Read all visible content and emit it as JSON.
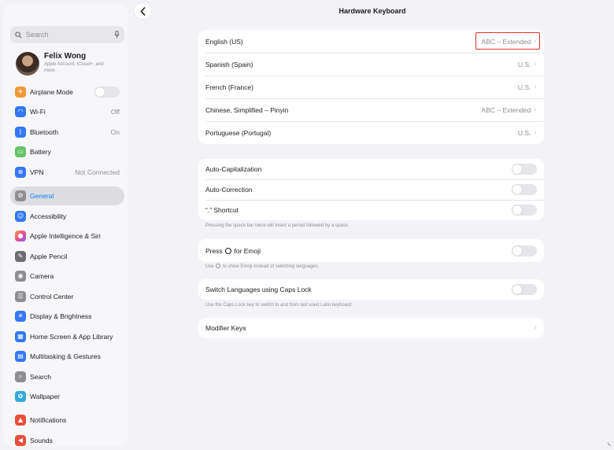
{
  "colors": {
    "accent": "#0a84ff",
    "highlight_box": "#e0312b"
  },
  "sidebar": {
    "search_placeholder": "Search",
    "profile": {
      "name": "Felix Wong",
      "subtitle": "Apple Account, iCloud+, and more"
    },
    "items": [
      {
        "label": "Airplane Mode",
        "icon": "airplane-icon",
        "color": "#f09a37",
        "toggle": "off"
      },
      {
        "label": "Wi-Fi",
        "icon": "wifi-icon",
        "color": "#3478f6",
        "value": "Off"
      },
      {
        "label": "Bluetooth",
        "icon": "bluetooth-icon",
        "color": "#3478f6",
        "value": "On"
      },
      {
        "label": "Battery",
        "icon": "battery-icon",
        "color": "#65c466"
      },
      {
        "label": "VPN",
        "icon": "vpn-icon",
        "color": "#3478f6",
        "value": "Not Connected"
      },
      {
        "label": "General",
        "icon": "gear-icon",
        "color": "#8e8e93",
        "selected": true
      },
      {
        "label": "Accessibility",
        "icon": "accessibility-icon",
        "color": "#3478f6"
      },
      {
        "label": "Apple Intelligence & Siri",
        "icon": "siri-icon",
        "color": "#e4508f"
      },
      {
        "label": "Apple Pencil",
        "icon": "pencil-icon",
        "color": "#6e6e73"
      },
      {
        "label": "Camera",
        "icon": "camera-icon",
        "color": "#8e8e93"
      },
      {
        "label": "Control Center",
        "icon": "control-center-icon",
        "color": "#8e8e93"
      },
      {
        "label": "Display & Brightness",
        "icon": "sun-icon",
        "color": "#3478f6"
      },
      {
        "label": "Home Screen & App Library",
        "icon": "home-screen-icon",
        "color": "#3478f6"
      },
      {
        "label": "Multitasking & Gestures",
        "icon": "multitasking-icon",
        "color": "#3478f6"
      },
      {
        "label": "Search",
        "icon": "search-icon",
        "color": "#8e8e93"
      },
      {
        "label": "Wallpaper",
        "icon": "wallpaper-icon",
        "color": "#35aadc"
      },
      {
        "label": "Notifications",
        "icon": "bell-icon",
        "color": "#eb4e3d"
      },
      {
        "label": "Sounds",
        "icon": "speaker-icon",
        "color": "#eb4e3d"
      }
    ]
  },
  "header": {
    "title": "Hardware Keyboard"
  },
  "keyboards": [
    {
      "label": "English (US)",
      "value": "ABC – Extended"
    },
    {
      "label": "Spanish (Spain)",
      "value": "U.S."
    },
    {
      "label": "French (France)",
      "value": "U.S."
    },
    {
      "label": "Chinese, Simplified – Pinyin",
      "value": "ABC – Extended"
    },
    {
      "label": "Portuguese (Portugal)",
      "value": "U.S."
    }
  ],
  "typing": {
    "auto_cap": "Auto-Capitalization",
    "auto_correct": "Auto-Correction",
    "shortcut": "“.” Shortcut",
    "footer": "Pressing the space bar twice will insert a period followed by a space."
  },
  "emoji": {
    "label_before": "Press",
    "label_after": "for Emoji",
    "footer_before": "Use",
    "footer_after": "to show Emoji instead of switching languages."
  },
  "caps_lock": {
    "label": "Switch Languages using Caps Lock",
    "footer": "Use the Caps Lock key to switch to and from last used Latin keyboard."
  },
  "modifier_keys": {
    "label": "Modifier Keys"
  }
}
